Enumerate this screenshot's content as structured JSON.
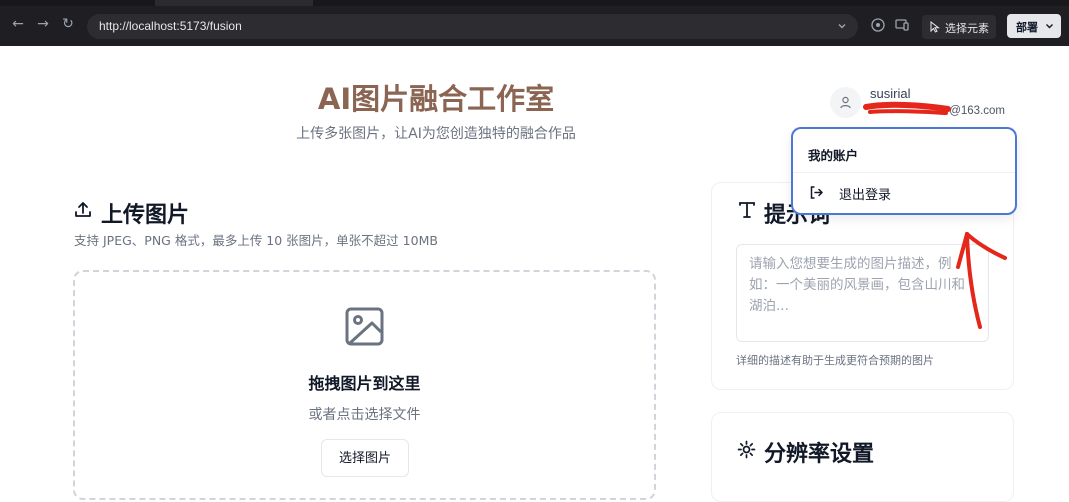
{
  "browser": {
    "url": "http://localhost:5173/fusion",
    "select_element_label": "选择元素",
    "deploy_label": "部署"
  },
  "header": {
    "title": "AI图片融合工作室",
    "subtitle": "上传多张图片，让AI为您创造独特的融合作品"
  },
  "user": {
    "name": "susirial",
    "email_suffix": "@163.com"
  },
  "account_menu": {
    "header": "我的账户",
    "logout": "退出登录"
  },
  "upload": {
    "title": "上传图片",
    "hint": "支持 JPEG、PNG 格式，最多上传 10 张图片，单张不超过 10MB",
    "drop_title": "拖拽图片到这里",
    "drop_sub": "或者点击选择文件",
    "choose_button": "选择图片"
  },
  "prompt": {
    "title": "提示词",
    "placeholder": "请输入您想要生成的图片描述，例如：一个美丽的风景画，包含山川和湖泊...",
    "help": "详细的描述有助于生成更符合预期的图片"
  },
  "resolution": {
    "title": "分辨率设置"
  },
  "colors": {
    "title_brown": "#8b6452",
    "menu_border": "#4a79d4",
    "annotation_red": "#e5261a"
  }
}
